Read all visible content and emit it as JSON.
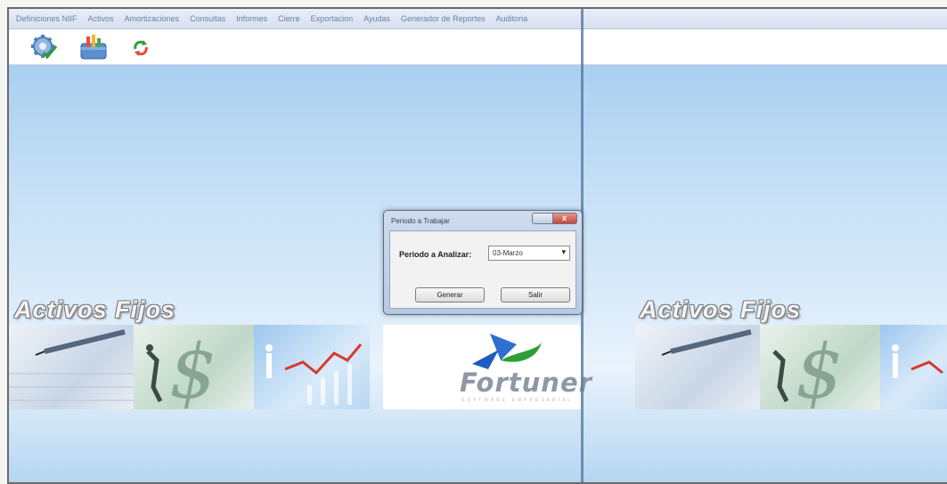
{
  "menu": {
    "items": [
      "Definiciones NIIF",
      "Activos",
      "Amortizaciones",
      "Consultas",
      "Informes",
      "Cierre",
      "Exportacion",
      "Ayudas",
      "Generador de Reportes",
      "Auditoria"
    ]
  },
  "toolbar": {
    "buttons": [
      "settings-gear-icon",
      "chart-folder-icon",
      "refresh-icon"
    ]
  },
  "background": {
    "brand_title": "Activos Fijos",
    "logo_name": "Fortuner",
    "logo_subtitle": "SOFTWARE EMPRESARIAL",
    "accent_color": "#2f6fd0",
    "green_accent": "#2e9e3a"
  },
  "dialog": {
    "title": "Periodo a Trabajar",
    "label": "Periodo a Analizar:",
    "select_value": "03-Marzo",
    "accept_label": "Generar",
    "exit_label": "Salir",
    "close_glyph": "x"
  }
}
